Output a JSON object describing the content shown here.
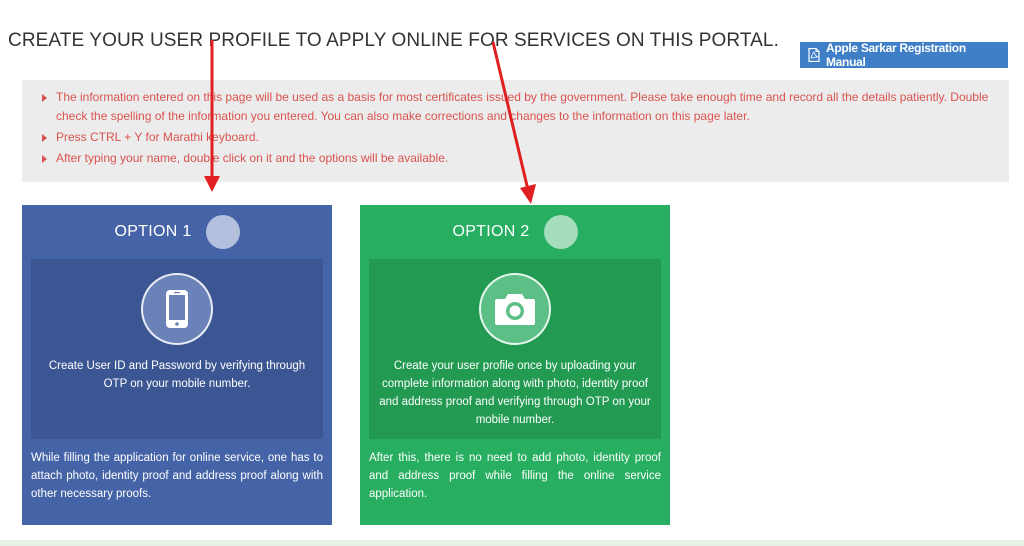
{
  "page": {
    "title": "CREATE YOUR USER PROFILE TO APPLY ONLINE FOR SERVICES ON THIS PORTAL."
  },
  "manual_button": {
    "label": "Apple Sarkar Registration Manual",
    "icon": "pdf-icon"
  },
  "notice": {
    "items": [
      "The information entered on this page will be used as a basis for most certificates issued by the government. Please take enough time and record all the details patiently. Double check the spelling of the information you entered. You can also make corrections and changes to the information on this page later.",
      "Press CTRL + Y for Marathi keyboard.",
      "After typing your name, double click on it and the options will be available."
    ]
  },
  "options": [
    {
      "heading": "OPTION 1",
      "icon": "mobile-phone-icon",
      "description": "Create User ID and Password by verifying through OTP on your mobile number.",
      "footer": "While filling the application for online service, one has to attach photo, identity proof and address proof along with other necessary proofs."
    },
    {
      "heading": "OPTION 2",
      "icon": "camera-icon",
      "description": "Create your user profile once by uploading your complete information along with photo, identity proof and address proof and verifying through OTP on your mobile number.",
      "footer": "After this, there is no need to add photo, identity proof and address proof while filling the online service application."
    }
  ],
  "colors": {
    "option1_bg": "#4563a7",
    "option2_bg": "#27ae60",
    "notice_text": "#d9534f",
    "manual_button_bg": "#3f7fc8",
    "annotation_arrow": "#e02020"
  }
}
